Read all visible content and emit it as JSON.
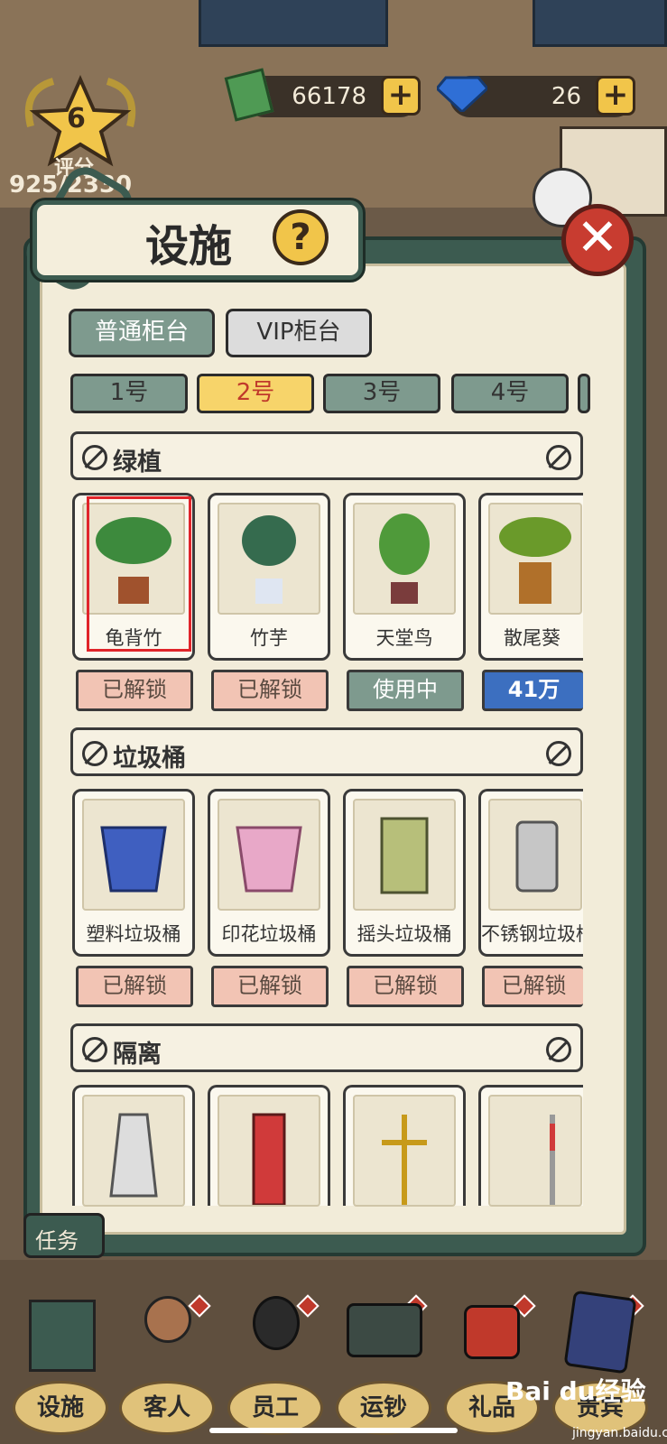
{
  "hud": {
    "level": "6",
    "rating_label": "评分",
    "rating_value": "925/2330",
    "cash": "66178",
    "gems": "26",
    "plus": "+"
  },
  "dialog": {
    "title": "设施",
    "help": "?",
    "close": "✕",
    "tabs": [
      "普通柜台",
      "VIP柜台"
    ],
    "counters": [
      "1号",
      "2号",
      "3号",
      "4号"
    ],
    "sections": [
      {
        "title": "绿植",
        "items": [
          {
            "name": "龟背竹",
            "status": "已解锁"
          },
          {
            "name": "竹芋",
            "status": "已解锁"
          },
          {
            "name": "天堂鸟",
            "status": "使用中"
          },
          {
            "name": "散尾葵",
            "status": "41万"
          }
        ]
      },
      {
        "title": "垃圾桶",
        "items": [
          {
            "name": "塑料垃圾桶",
            "status": "已解锁"
          },
          {
            "name": "印花垃圾桶",
            "status": "已解锁"
          },
          {
            "name": "摇头垃圾桶",
            "status": "已解锁"
          },
          {
            "name": "不锈钢垃圾桶",
            "status": "已解锁"
          }
        ]
      },
      {
        "title": "隔离"
      }
    ]
  },
  "task_button": "任务",
  "bottom_nav": [
    "设施",
    "客人",
    "员工",
    "运钞",
    "礼品",
    "贵宾"
  ],
  "watermark": {
    "brand": "Bai du经验",
    "url": "jingyan.baidu.com"
  },
  "colors": {
    "accent": "#f1c54a",
    "panel": "#3c5b50",
    "close": "#c83c30",
    "highlight": "#e0242a"
  }
}
